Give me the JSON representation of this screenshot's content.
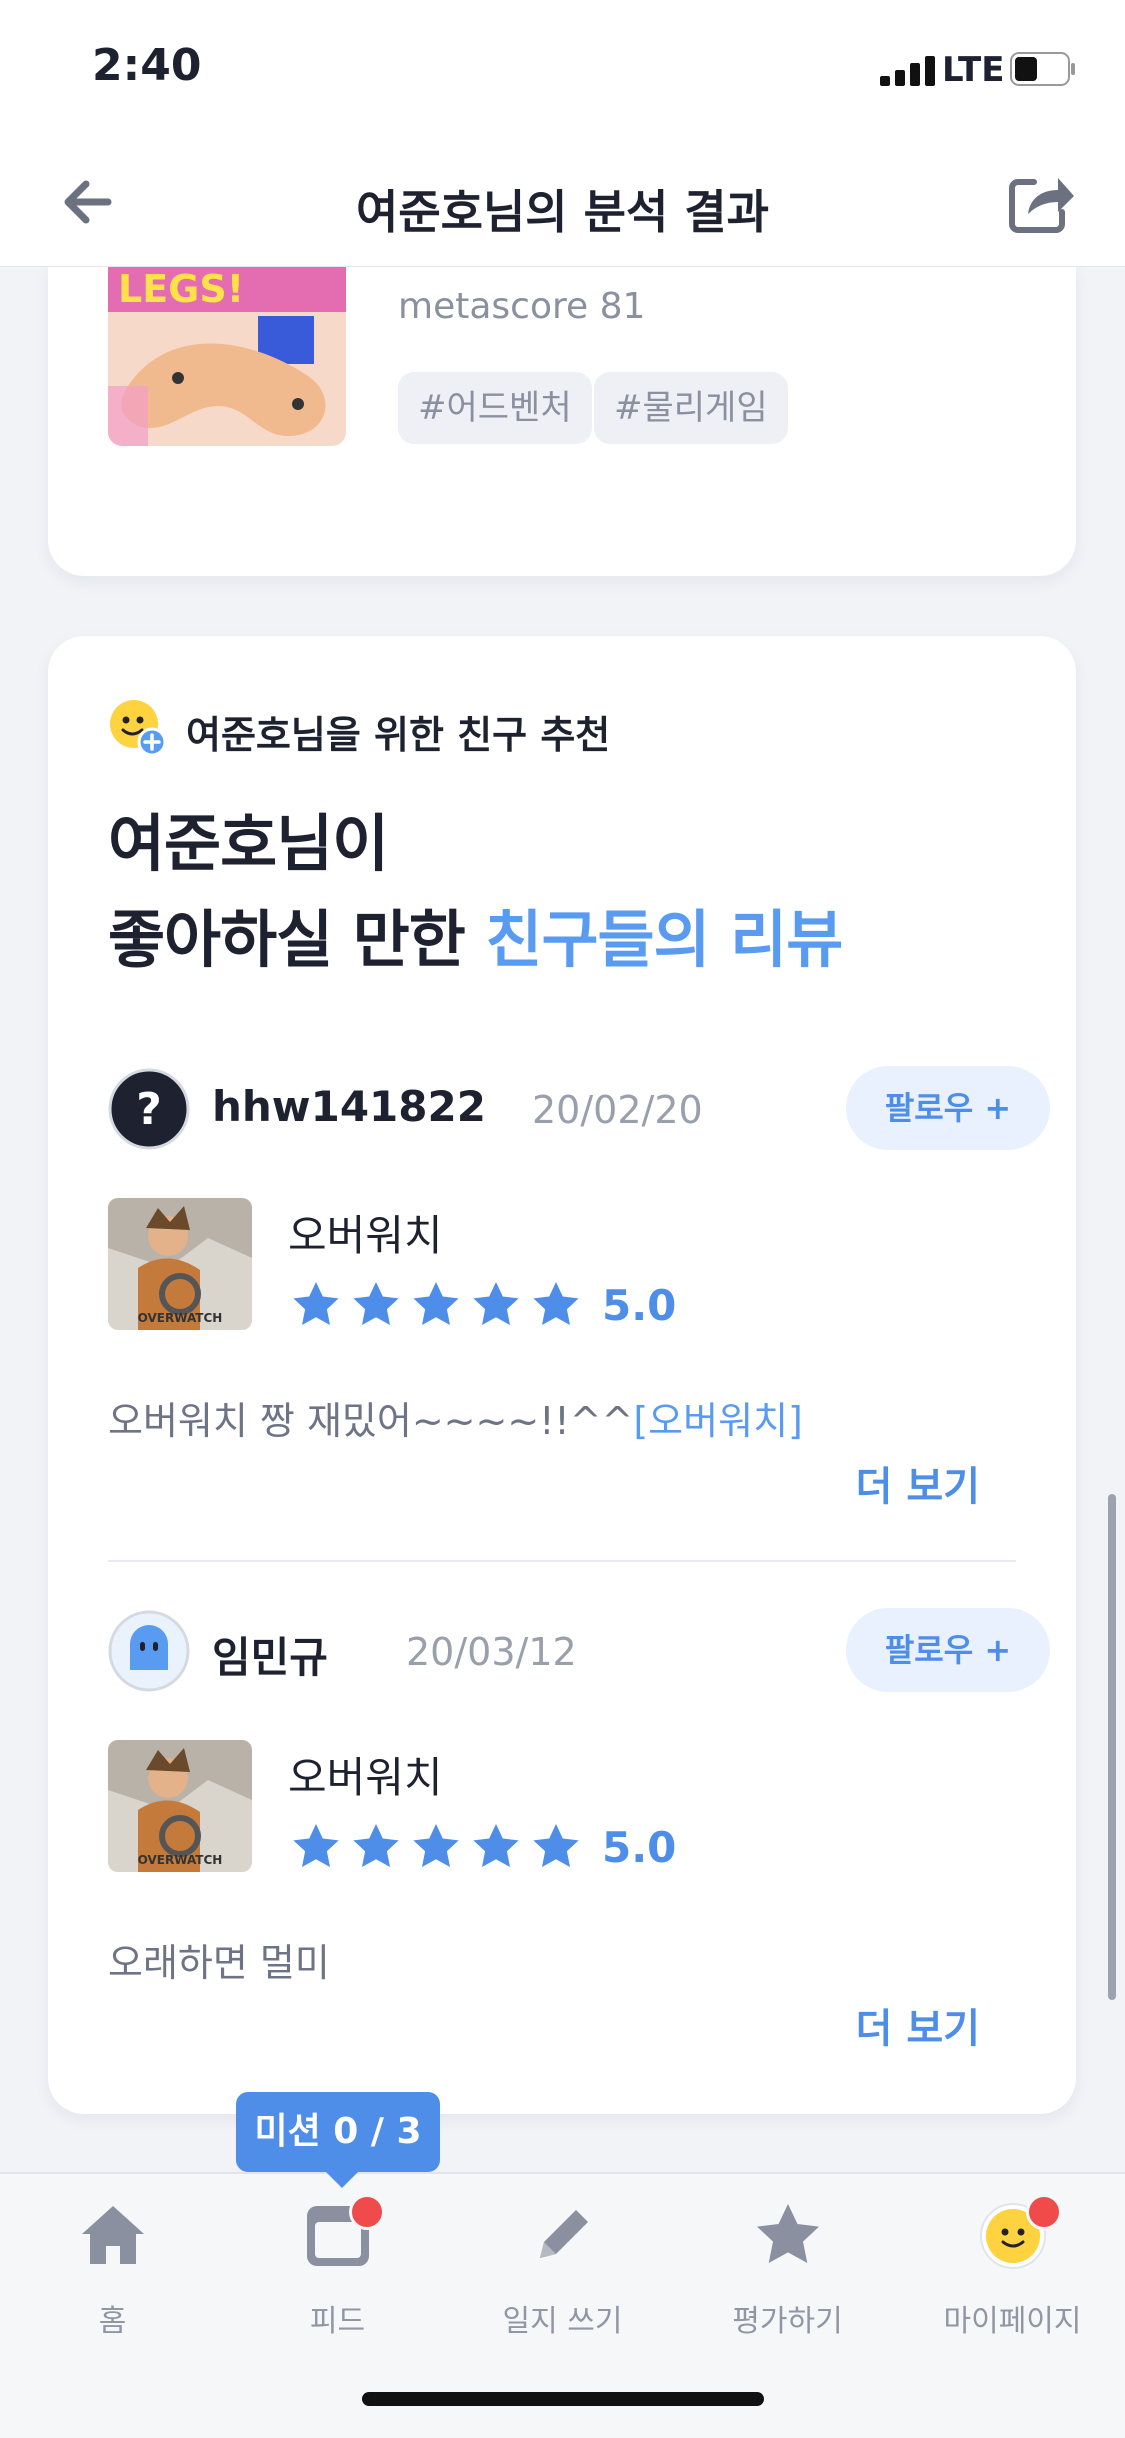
{
  "status_bar": {
    "time": "2:40",
    "network": "LTE"
  },
  "header": {
    "title": "여준호님의 분석 결과"
  },
  "top_card": {
    "metascore": "metascore 81",
    "tags": [
      "#어드벤처",
      "#물리게임"
    ]
  },
  "recommend_card": {
    "section_label": "여준호님을 위한 친구 추천",
    "headline_line1": "여준호님이",
    "headline_line2_plain": "좋아하실 만한 ",
    "headline_line2_accent": "친구들의 리뷰",
    "reviews": [
      {
        "username": "hhw141822",
        "date": "20/02/20",
        "follow_label": "팔로우 +",
        "game": "오버워치",
        "thumb_text": "OVERWATCH",
        "rating": "5.0",
        "stars": 5,
        "text": "오버워치 짱 재밌어~~~~!!^^",
        "text_link": "[오버워치]",
        "more_label": "더 보기"
      },
      {
        "username": "임민규",
        "date": "20/03/12",
        "follow_label": "팔로우 +",
        "game": "오버워치",
        "thumb_text": "OVERWATCH",
        "rating": "5.0",
        "stars": 5,
        "text": "오래하면 멀미",
        "text_link": "",
        "more_label": "더 보기"
      }
    ]
  },
  "mission": {
    "label": "미션 0 / 3"
  },
  "tabs": [
    {
      "label": "홈",
      "icon": "home-icon"
    },
    {
      "label": "피드",
      "icon": "feed-icon"
    },
    {
      "label": "일지 쓰기",
      "icon": "pencil-icon"
    },
    {
      "label": "평가하기",
      "icon": "star-icon"
    },
    {
      "label": "마이페이지",
      "icon": "profile-icon"
    }
  ],
  "colors": {
    "accent": "#4E8EE8",
    "badge": "#F04A4A"
  }
}
